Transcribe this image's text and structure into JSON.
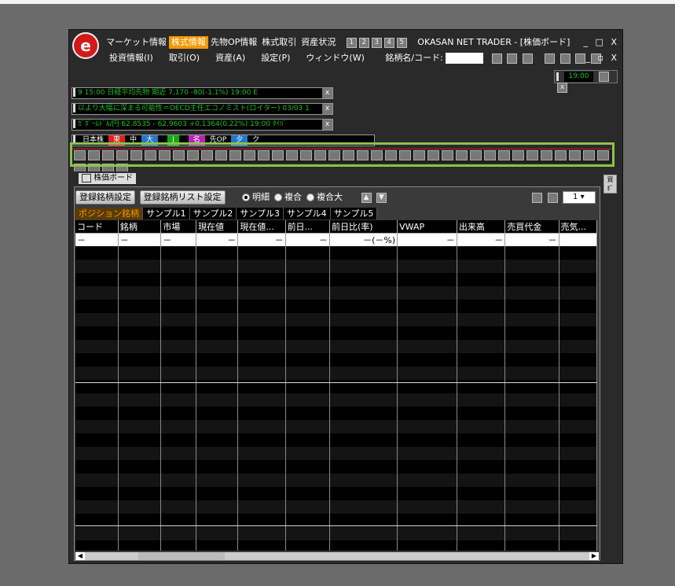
{
  "menu_top": [
    "マーケット情報",
    "株式情報",
    "先物OP情報",
    "株式取引",
    "資産状況"
  ],
  "menu_top_active": 1,
  "menu_top_squares": [
    "1",
    "2",
    "3",
    "4",
    "5"
  ],
  "app_title": "OKASAN NET TRADER - [株価ボード]",
  "menu_second": [
    "投資情報(I)",
    "取引(O)",
    "資産(A)",
    "設定(P)",
    "ウィンドウ(W)"
  ],
  "code_label": "銘柄名/コード:",
  "time_display": "19:00",
  "tickers": [
    "9  15:00   日経平均先物 期近 7,170  -80(-1.1%)  19:00         E",
    "以より大幅に深まる可能性＝OECD主任エコノミスト(ロイター)  03/03 1",
    "ｶﾞﾎﾟｰﾙﾄﾞﾙ/円 62.8535 - 62.9603  +0.1364(0.22%)  19:00     ﾀｲﾊﾞ"
  ],
  "index_bar": [
    "日本株",
    "東",
    "中",
    "大",
    "",
    "J",
    "",
    "名",
    "先OP",
    "夕",
    "ク"
  ],
  "panel_title": "株価ボード",
  "buttons": {
    "register": "登録銘柄設定",
    "register_list": "登録銘柄リスト設定"
  },
  "radios": [
    {
      "label": "明細",
      "on": true
    },
    {
      "label": "複合",
      "on": false
    },
    {
      "label": "複合大",
      "on": false
    }
  ],
  "page_number": "1",
  "tabs": [
    "ポジション銘柄",
    "サンプル1",
    "サンプル2",
    "サンプル3",
    "サンプル4",
    "サンプル5"
  ],
  "tab_active": 0,
  "columns": [
    "コード",
    "銘柄",
    "市場",
    "現在値",
    "現在値...",
    "前日...",
    "前日比(率)",
    "VWAP",
    "出来高",
    "売買代金",
    "売気..."
  ],
  "first_row": [
    "－",
    "－",
    "－",
    "－",
    "－",
    "－",
    "－(－%)",
    "－",
    "－",
    "－",
    ""
  ],
  "side_tab": "買ﾎﾟ"
}
